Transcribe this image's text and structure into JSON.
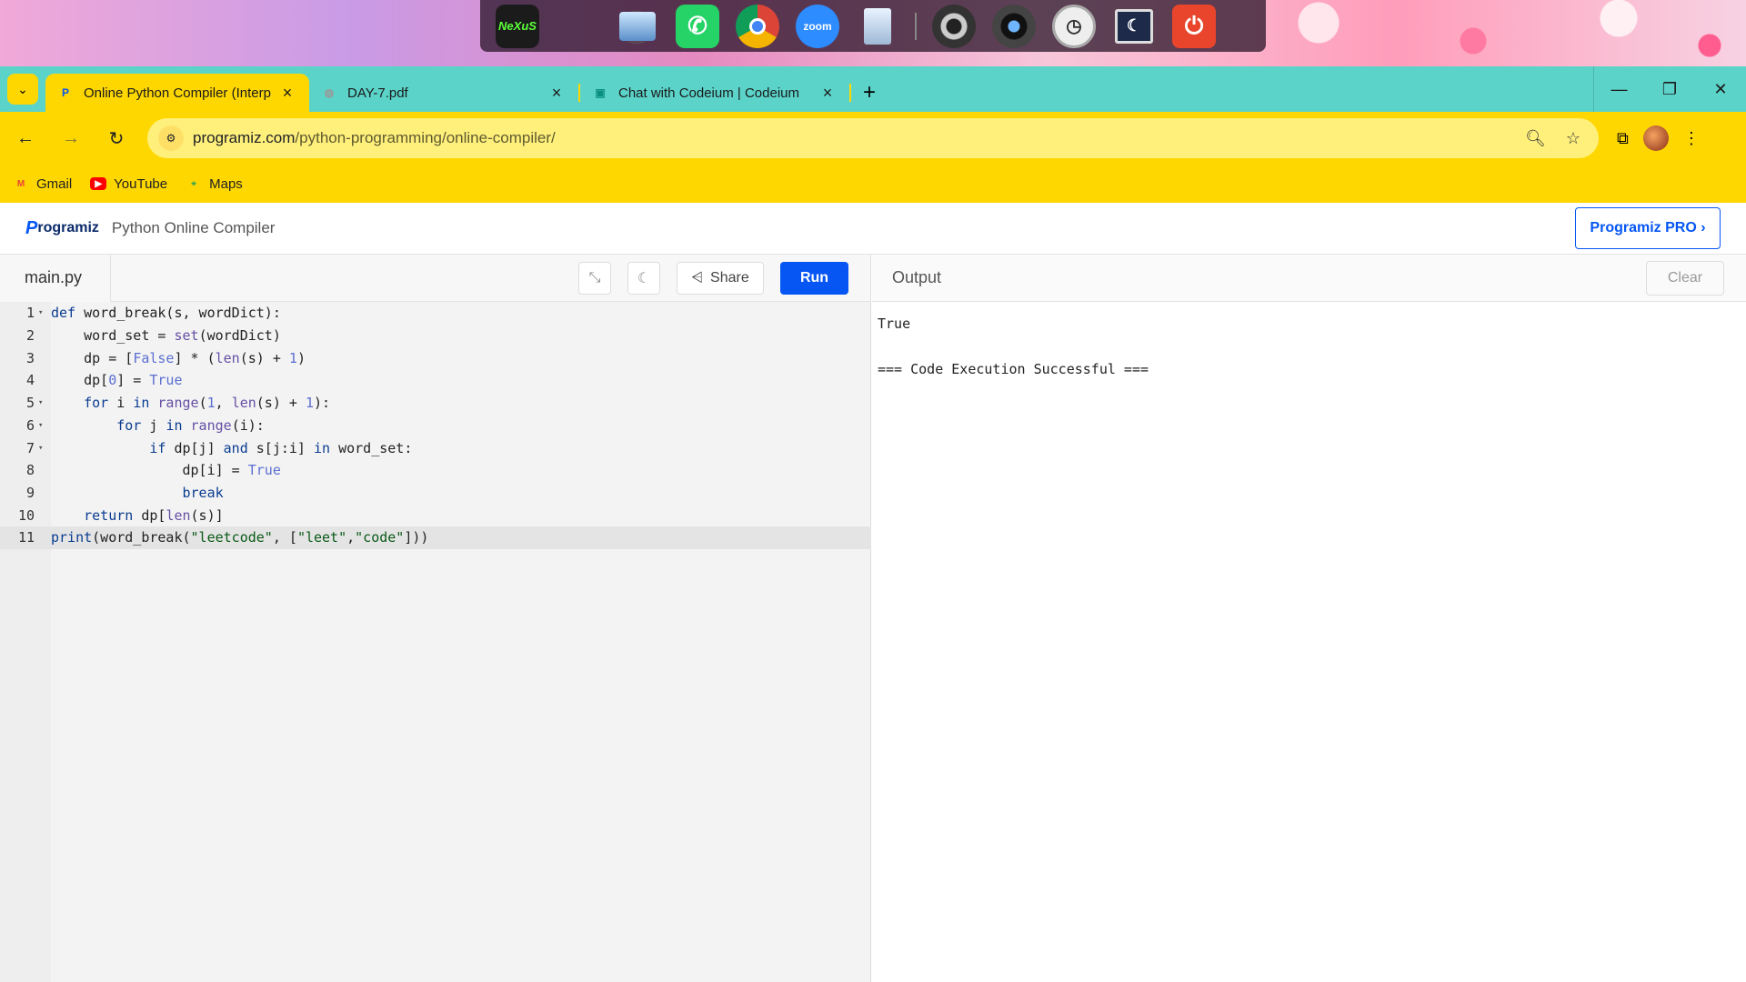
{
  "dock": {
    "icons": [
      "nexus-icon",
      "windows-icon",
      "computer-icon",
      "whatsapp-icon",
      "chrome-icon",
      "zoom-icon",
      "recycle-bin-icon",
      "speaker-icon",
      "camera-icon",
      "clock-icon",
      "monitor-icon",
      "power-icon"
    ],
    "nexus_label": "NeXuS",
    "zoom_label": "zoom"
  },
  "tabs": [
    {
      "title": "Online Python Compiler (Interp",
      "active": true
    },
    {
      "title": "DAY-7.pdf",
      "active": false
    },
    {
      "title": "Chat with Codeium | Codeium",
      "active": false
    }
  ],
  "toolbar": {
    "url_host": "programiz.com",
    "url_path": "/python-programming/online-compiler/"
  },
  "bookmarks": [
    {
      "label": "Gmail"
    },
    {
      "label": "YouTube"
    },
    {
      "label": "Maps"
    }
  ],
  "header": {
    "logo_text": "rogramiz",
    "logo_p": "P",
    "title": "Python Online Compiler",
    "pro_button": "Programiz PRO ›"
  },
  "editor": {
    "file_name": "main.py",
    "share_label": "Share",
    "run_label": "Run",
    "active_line": 11
  },
  "output": {
    "title": "Output",
    "clear_label": "Clear",
    "text": "True\n\n=== Code Execution Successful ==="
  },
  "colors": {
    "tabbar": "#5bd3c9",
    "toolbar": "#ffd700",
    "brand_blue": "#0556f3"
  }
}
